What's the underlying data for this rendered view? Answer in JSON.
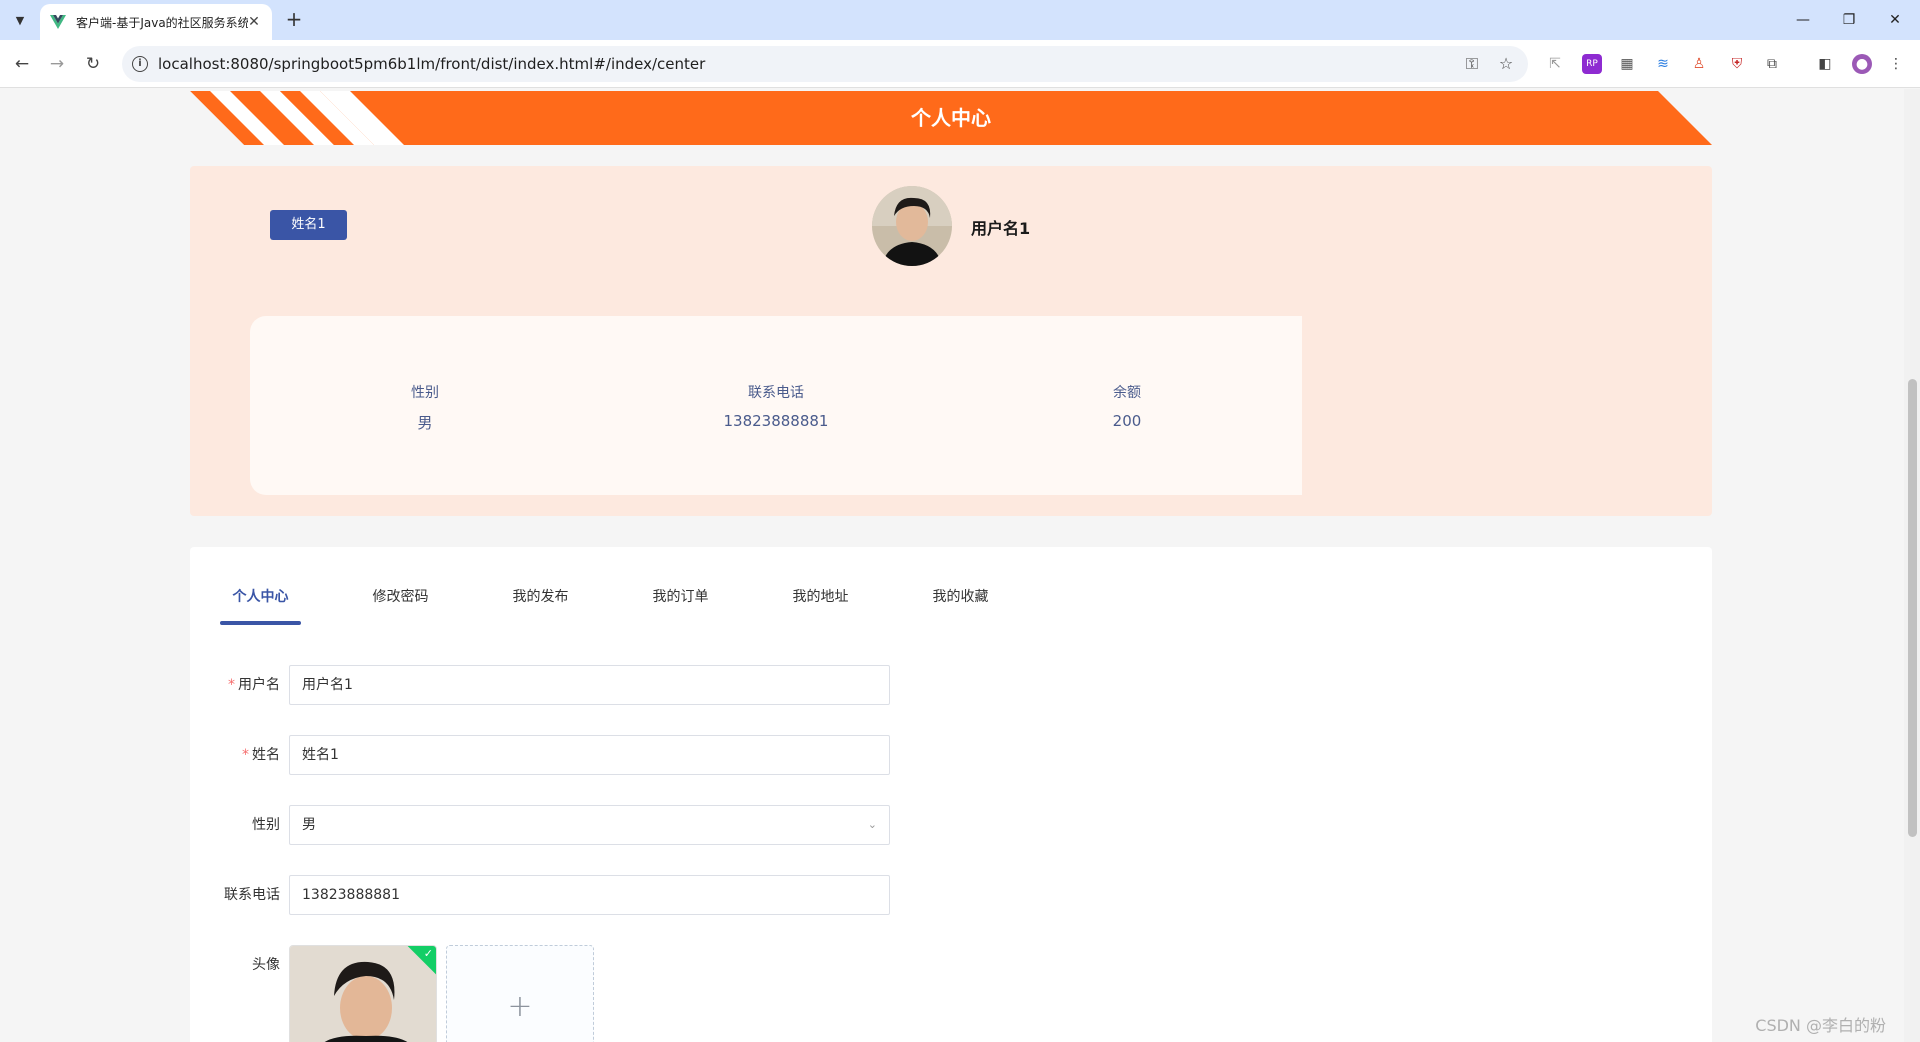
{
  "browser": {
    "tab_title": "客户端-基于Java的社区服务系统",
    "url": "localhost:8080/springboot5pm6b1lm/front/dist/index.html#/index/center"
  },
  "page": {
    "banner_title": "个人中心",
    "profile": {
      "name_tag": "姓名1",
      "username": "用户名1",
      "info": [
        {
          "label": "性别",
          "value": "男"
        },
        {
          "label": "联系电话",
          "value": "13823888881"
        },
        {
          "label": "余额",
          "value": "200"
        }
      ]
    },
    "tabs": [
      "个人中心",
      "修改密码",
      "我的发布",
      "我的订单",
      "我的地址",
      "我的收藏"
    ],
    "active_tab": "个人中心",
    "form": {
      "username": {
        "label": "用户名",
        "value": "用户名1",
        "required": true
      },
      "name": {
        "label": "姓名",
        "value": "姓名1",
        "required": true
      },
      "gender": {
        "label": "性别",
        "value": "男"
      },
      "phone": {
        "label": "联系电话",
        "value": "13823888881"
      },
      "avatar": {
        "label": "头像",
        "add_symbol": "+"
      }
    },
    "required_mark": "*"
  },
  "watermark": "CSDN @李白的粉",
  "colors": {
    "accent": "#3a55a6",
    "banner": "#ff6a1a",
    "profile_bg": "#fde9df"
  }
}
